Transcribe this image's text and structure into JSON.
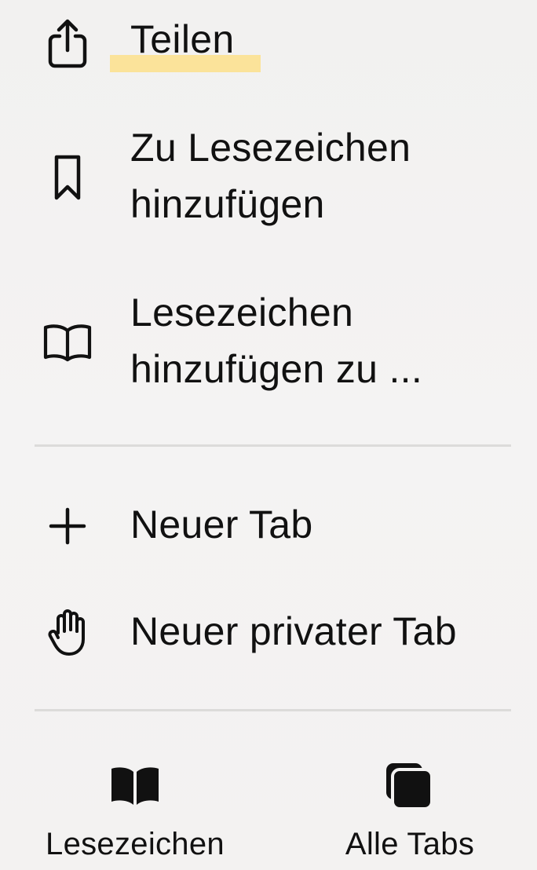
{
  "menu": {
    "items": [
      {
        "label": "Teilen",
        "icon": "share-icon"
      },
      {
        "label": "Zu Lesezeichen\nhinzufügen",
        "icon": "bookmark-icon"
      },
      {
        "label": "Lesezeichen\nhinzufügen zu ...",
        "icon": "book-icon"
      },
      {
        "label": "Neuer Tab",
        "icon": "plus-icon"
      },
      {
        "label": "Neuer privater Tab",
        "icon": "hand-icon"
      }
    ]
  },
  "bottom_bar": {
    "bookmarks_label": "Lesezeichen",
    "bookmarks_icon": "book-filled-icon",
    "tabs_label": "Alle Tabs",
    "tabs_icon": "tabs-stack-icon"
  },
  "colors": {
    "background": "#f3f2f1",
    "text": "#111111",
    "highlight": "#fbe39a",
    "divider": "#dcdbda"
  }
}
